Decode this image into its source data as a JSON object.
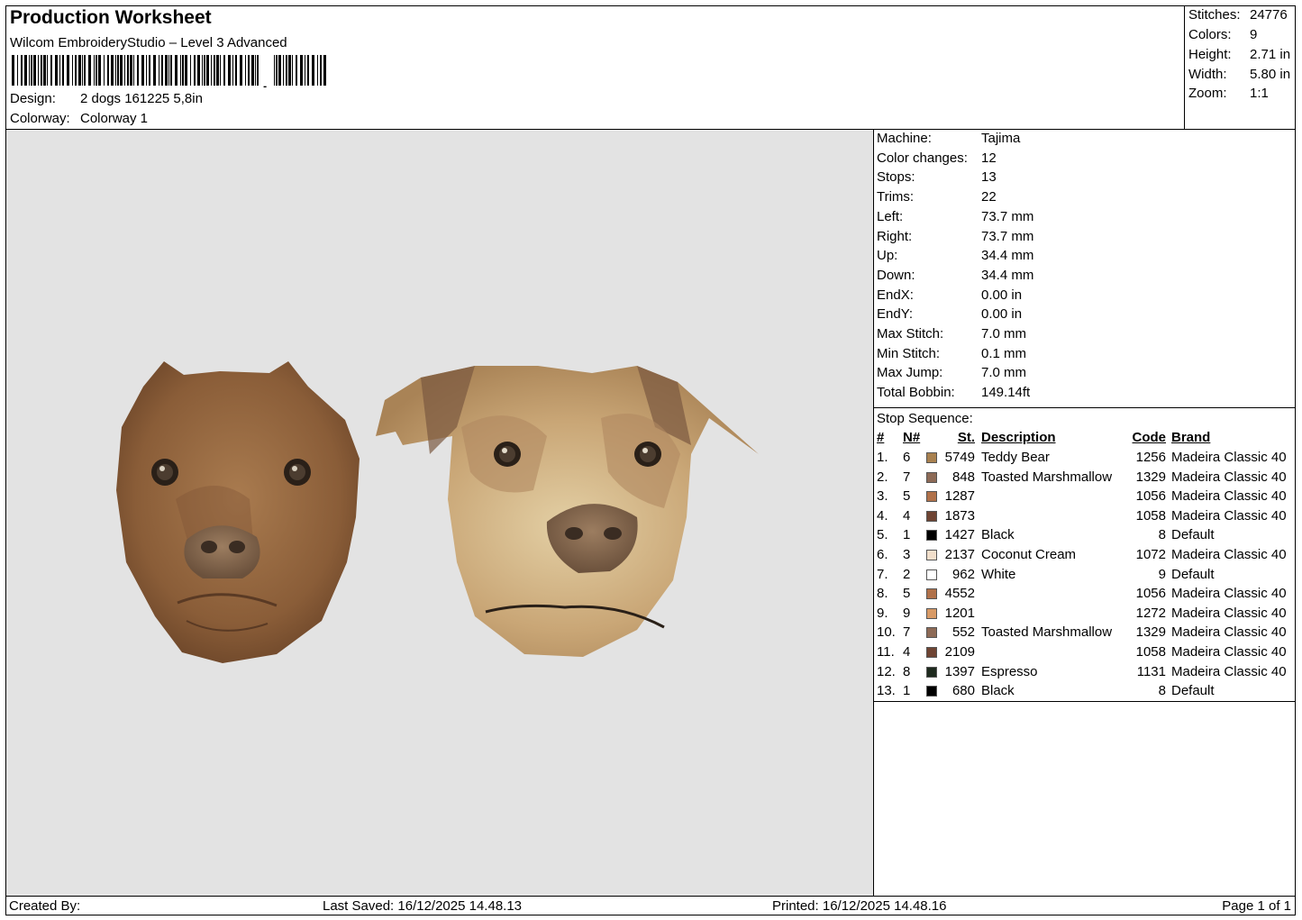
{
  "header": {
    "title": "Production Worksheet",
    "software": "Wilcom EmbroideryStudio – Level 3 Advanced",
    "design_label": "Design:",
    "design_value": "2 dogs 161225 5,8in",
    "colorway_label": "Colorway:",
    "colorway_value": "Colorway 1"
  },
  "stats": [
    {
      "label": "Stitches:",
      "value": "24776"
    },
    {
      "label": "Colors:",
      "value": "9"
    },
    {
      "label": "Height:",
      "value": "2.71 in"
    },
    {
      "label": "Width:",
      "value": "5.80 in"
    },
    {
      "label": "Zoom:",
      "value": "1:1"
    }
  ],
  "machine_info": [
    {
      "label": "Machine:",
      "value": "Tajima"
    },
    {
      "label": "Color changes:",
      "value": "12"
    },
    {
      "label": "Stops:",
      "value": "13"
    },
    {
      "label": "Trims:",
      "value": "22"
    },
    {
      "label": "Left:",
      "value": "73.7 mm"
    },
    {
      "label": "Right:",
      "value": "73.7 mm"
    },
    {
      "label": "Up:",
      "value": "34.4 mm"
    },
    {
      "label": "Down:",
      "value": "34.4 mm"
    },
    {
      "label": "EndX:",
      "value": "0.00 in"
    },
    {
      "label": "EndY:",
      "value": "0.00 in"
    },
    {
      "label": "Max Stitch:",
      "value": "7.0 mm"
    },
    {
      "label": "Min Stitch:",
      "value": "0.1 mm"
    },
    {
      "label": "Max Jump:",
      "value": "7.0 mm"
    },
    {
      "label": "Total Bobbin:",
      "value": "149.14ft"
    }
  ],
  "stop_sequence": {
    "title": "Stop Sequence:",
    "columns": {
      "idx": "#",
      "n": "N#",
      "st": "St.",
      "desc": "Description",
      "code": "Code",
      "brand": "Brand"
    },
    "rows": [
      {
        "idx": "1.",
        "n": "6",
        "color": "#a8804f",
        "st": "5749",
        "desc": "Teddy Bear",
        "code": "1256",
        "brand": "Madeira Classic 40"
      },
      {
        "idx": "2.",
        "n": "7",
        "color": "#8d6a56",
        "st": "848",
        "desc": "Toasted Marshmallow",
        "code": "1329",
        "brand": "Madeira Classic 40"
      },
      {
        "idx": "3.",
        "n": "5",
        "color": "#b0714a",
        "st": "1287",
        "desc": "",
        "code": "1056",
        "brand": "Madeira Classic 40"
      },
      {
        "idx": "4.",
        "n": "4",
        "color": "#6e4433",
        "st": "1873",
        "desc": "",
        "code": "1058",
        "brand": "Madeira Classic 40"
      },
      {
        "idx": "5.",
        "n": "1",
        "color": "#000000",
        "st": "1427",
        "desc": "Black",
        "code": "8",
        "brand": "Default"
      },
      {
        "idx": "6.",
        "n": "3",
        "color": "#f2dfcb",
        "st": "2137",
        "desc": "Coconut Cream",
        "code": "1072",
        "brand": "Madeira Classic 40"
      },
      {
        "idx": "7.",
        "n": "2",
        "color": "#ffffff",
        "st": "962",
        "desc": "White",
        "code": "9",
        "brand": "Default"
      },
      {
        "idx": "8.",
        "n": "5",
        "color": "#b0714a",
        "st": "4552",
        "desc": "",
        "code": "1056",
        "brand": "Madeira Classic 40"
      },
      {
        "idx": "9.",
        "n": "9",
        "color": "#d89a66",
        "st": "1201",
        "desc": "",
        "code": "1272",
        "brand": "Madeira Classic 40"
      },
      {
        "idx": "10.",
        "n": "7",
        "color": "#8d6a56",
        "st": "552",
        "desc": "Toasted Marshmallow",
        "code": "1329",
        "brand": "Madeira Classic 40"
      },
      {
        "idx": "11.",
        "n": "4",
        "color": "#6e4433",
        "st": "2109",
        "desc": "",
        "code": "1058",
        "brand": "Madeira Classic 40"
      },
      {
        "idx": "12.",
        "n": "8",
        "color": "#1e2a1e",
        "st": "1397",
        "desc": "Espresso",
        "code": "1131",
        "brand": "Madeira Classic 40"
      },
      {
        "idx": "13.",
        "n": "1",
        "color": "#000000",
        "st": "680",
        "desc": "Black",
        "code": "8",
        "brand": "Default"
      }
    ]
  },
  "footer": {
    "created_by": "Created By:",
    "last_saved": "Last Saved: 16/12/2025 14.48.13",
    "printed": "Printed: 16/12/2025 14.48.16",
    "page": "Page 1 of 1"
  }
}
